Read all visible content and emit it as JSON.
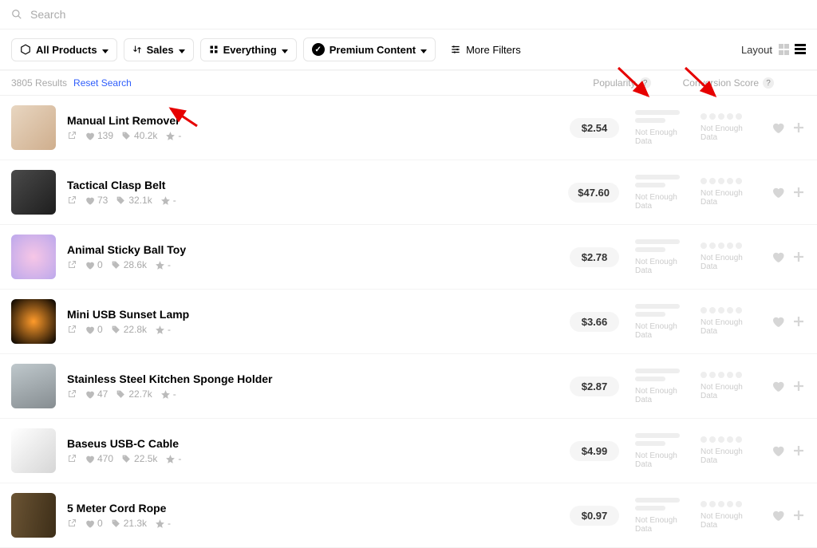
{
  "search": {
    "placeholder": "Search"
  },
  "filters": {
    "products": "All Products",
    "sales": "Sales",
    "everything": "Everything",
    "premium": "Premium Content",
    "more": "More Filters"
  },
  "layout_label": "Layout",
  "results_count": "3805 Results",
  "reset": "Reset Search",
  "col_popularity": "Popularity",
  "col_conversion": "Conversion Score",
  "not_enough": "Not Enough Data",
  "products": [
    {
      "title": "Manual Lint Remover",
      "likes": "139",
      "tags": "40.2k",
      "price": "$2.54"
    },
    {
      "title": "Tactical Clasp Belt",
      "likes": "73",
      "tags": "32.1k",
      "price": "$47.60"
    },
    {
      "title": "Animal Sticky Ball Toy",
      "likes": "0",
      "tags": "28.6k",
      "price": "$2.78"
    },
    {
      "title": "Mini USB Sunset Lamp",
      "likes": "0",
      "tags": "22.8k",
      "price": "$3.66"
    },
    {
      "title": "Stainless Steel Kitchen Sponge Holder",
      "likes": "47",
      "tags": "22.7k",
      "price": "$2.87"
    },
    {
      "title": "Baseus USB-C Cable",
      "likes": "470",
      "tags": "22.5k",
      "price": "$4.99"
    },
    {
      "title": "5 Meter Cord Rope",
      "likes": "0",
      "tags": "21.3k",
      "price": "$0.97"
    }
  ],
  "thumb_styles": [
    "linear-gradient(135deg,#e8d6c1,#cfae8d)",
    "linear-gradient(135deg,#4a4a4a,#1e1e1e)",
    "radial-gradient(circle,#f7c6e6,#bca8ec)",
    "radial-gradient(circle,#ff9b2b,#000)",
    "linear-gradient(160deg,#bfc8cc,#868d91)",
    "linear-gradient(135deg,#fff,#d6d6d6)",
    "linear-gradient(100deg,#6b5434,#3d2e18)"
  ]
}
